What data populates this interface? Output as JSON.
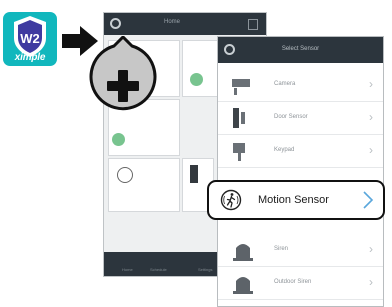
{
  "app": {
    "brand": "ximple",
    "badge": "W2"
  },
  "back_screen": {
    "title": "Home",
    "tabs": [
      "Home",
      "Schedule",
      "Settings"
    ]
  },
  "sensor_list": {
    "title": "Select Sensor",
    "items": [
      {
        "label": "Camera",
        "icon": "camera-icon"
      },
      {
        "label": "Door Sensor",
        "icon": "door-sensor-icon"
      },
      {
        "label": "Keypad",
        "icon": "keypad-icon"
      },
      {
        "label": "Motion Sensor",
        "icon": "motion-sensor-icon"
      },
      {
        "label": "Siren",
        "icon": "siren-icon"
      },
      {
        "label": "Outdoor Siren",
        "icon": "outdoor-siren-icon"
      }
    ]
  },
  "colors": {
    "accent": "#11b7bd",
    "header": "#2c353d",
    "plus_fill": "#c7c7c7",
    "chevron": "#5aa7dc"
  }
}
